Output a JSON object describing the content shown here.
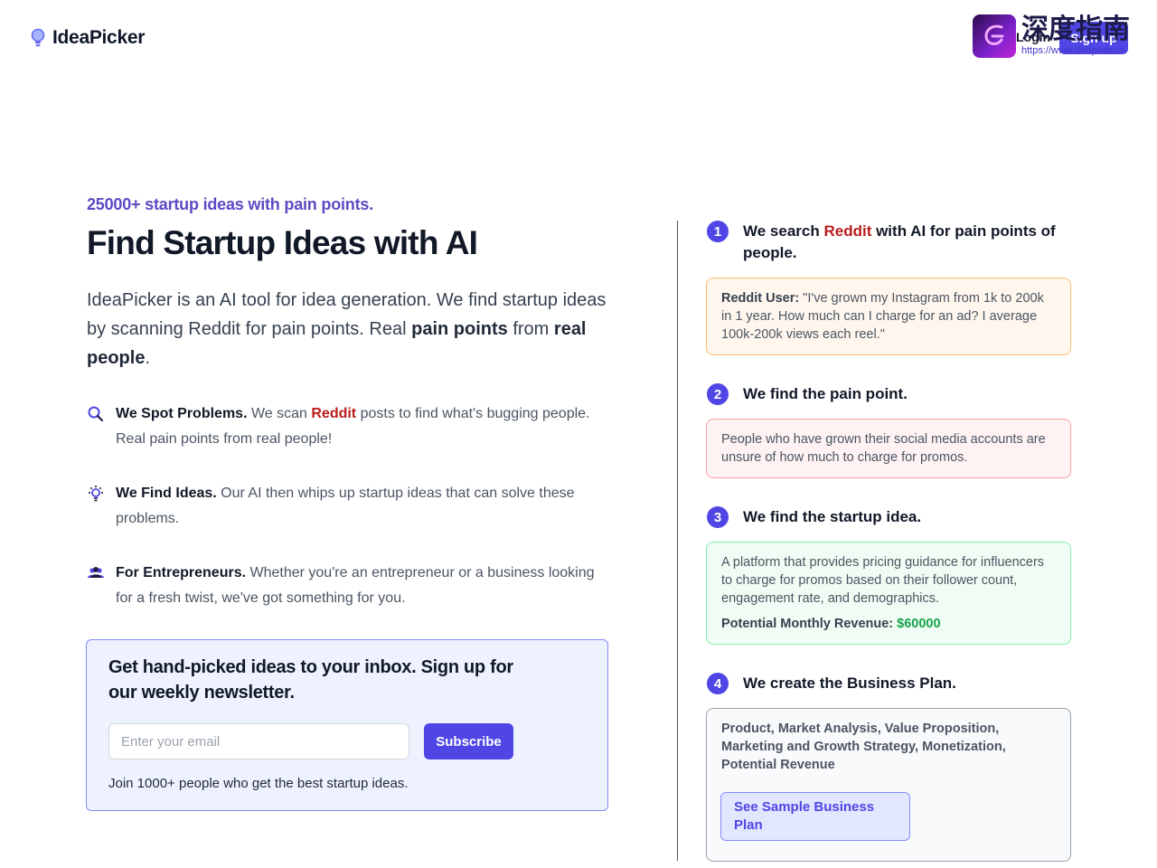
{
  "header": {
    "logo_text": "IdeaPicker",
    "login_label": "Login",
    "signup_label": "Sign up",
    "watermark_title": "深度指南",
    "watermark_url": "https://www.deepnav.cn"
  },
  "hero": {
    "tagline": "25000+ startup ideas with pain points.",
    "title": "Find Startup Ideas with AI",
    "desc_part1": "IdeaPicker is an AI tool for idea generation. We find startup ideas by scanning Reddit for pain points. Real ",
    "desc_bold1": "pain points",
    "desc_part2": " from ",
    "desc_bold2": "real people",
    "desc_part3": "."
  },
  "features": [
    {
      "icon": "search-icon",
      "title": "We Spot Problems.",
      "pre": " We scan ",
      "highlight": "Reddit",
      "post": " posts to find what's bugging people. Real pain points from real people!"
    },
    {
      "icon": "lightbulb-icon",
      "title": "We Find Ideas.",
      "pre": " Our AI then whips up startup ideas that can solve these problems.",
      "highlight": "",
      "post": ""
    },
    {
      "icon": "users-icon",
      "title": "For Entrepreneurs.",
      "pre": " Whether you're an entrepreneur or a business looking for a fresh twist, we've got something for you.",
      "highlight": "",
      "post": ""
    }
  ],
  "newsletter": {
    "title": "Get hand-picked ideas to your inbox. Sign up for our weekly newsletter.",
    "placeholder": "Enter your email",
    "button": "Subscribe",
    "note": "Join 1000+ people who get the best startup ideas."
  },
  "steps": [
    {
      "num": "1",
      "title_pre": "We search ",
      "title_highlight": "Reddit",
      "title_post": " with AI for pain points of people."
    },
    {
      "num": "2",
      "title_pre": "We find the pain point.",
      "title_highlight": "",
      "title_post": ""
    },
    {
      "num": "3",
      "title_pre": "We find the startup idea.",
      "title_highlight": "",
      "title_post": ""
    },
    {
      "num": "4",
      "title_pre": "We create the Business Plan.",
      "title_highlight": "",
      "title_post": ""
    }
  ],
  "cards": {
    "reddit_label": "Reddit User:",
    "reddit_quote": " \"I've grown my Instagram from 1k to 200k in 1 year. How much can I charge for an ad? I average 100k-200k views each reel.\"",
    "pain_point": "People who have grown their social media accounts are unsure of how much to charge for promos.",
    "idea": "A platform that provides pricing guidance for influencers to charge for promos based on their follower count, engagement rate, and demographics.",
    "revenue_label": "Potential Monthly Revenue:",
    "revenue_value": "$60000",
    "plan_items": "Product, Market Analysis, Value Proposition, Marketing and Growth Strategy, Monetization, Potential Revenue",
    "sample_button": "See Sample Business Plan"
  },
  "colors": {
    "accent": "#4f46e5",
    "reddit": "#b91c1c",
    "revenue": "#16a34a"
  }
}
